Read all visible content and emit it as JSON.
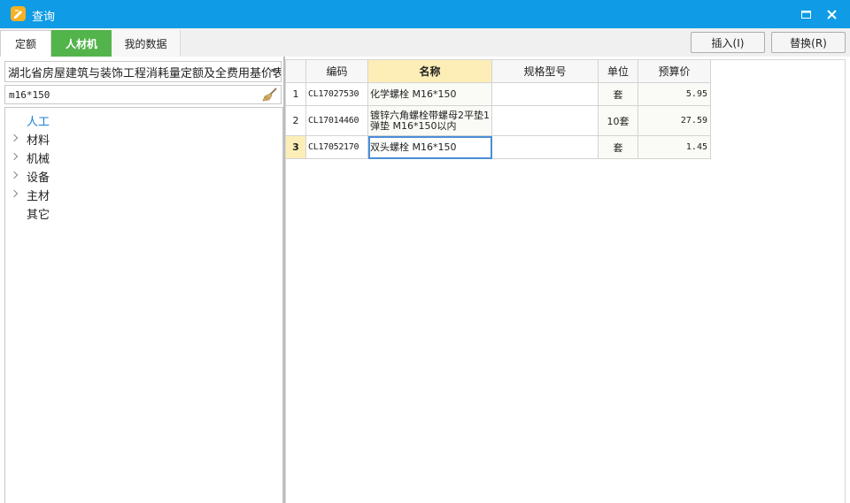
{
  "window": {
    "title": "查询",
    "accent": "#0f9be6"
  },
  "tabs": [
    {
      "label": "定额"
    },
    {
      "label": "人材机"
    },
    {
      "label": "我的数据"
    }
  ],
  "actions": {
    "insert_label": "插入(I)",
    "replace_label": "替换(R)"
  },
  "left": {
    "library": "湖北省房屋建筑与装饰工程消耗量定额及全费用基价表(",
    "search_value": "m16*150",
    "tree": [
      {
        "label": "人工",
        "expandable": false,
        "selected": true
      },
      {
        "label": "材料",
        "expandable": true
      },
      {
        "label": "机械",
        "expandable": true
      },
      {
        "label": "设备",
        "expandable": true
      },
      {
        "label": "主材",
        "expandable": true
      },
      {
        "label": "其它",
        "expandable": false
      }
    ]
  },
  "grid": {
    "columns": [
      "编码",
      "名称",
      "规格型号",
      "单位",
      "预算价"
    ],
    "active_column": "名称",
    "rows": [
      {
        "num": "1",
        "code": "CL17027530",
        "name": "化学螺栓 M16*150",
        "spec": "",
        "unit": "套",
        "price": "5.95"
      },
      {
        "num": "2",
        "code": "CL17014460",
        "name": "镀锌六角螺栓带螺母2平垫1弹垫 M16*150以内",
        "spec": "",
        "unit": "10套",
        "price": "27.59"
      },
      {
        "num": "3",
        "code": "CL17052170",
        "name": "双头螺栓 M16*150",
        "spec": "",
        "unit": "套",
        "price": "1.45"
      }
    ],
    "current_row": 3
  }
}
